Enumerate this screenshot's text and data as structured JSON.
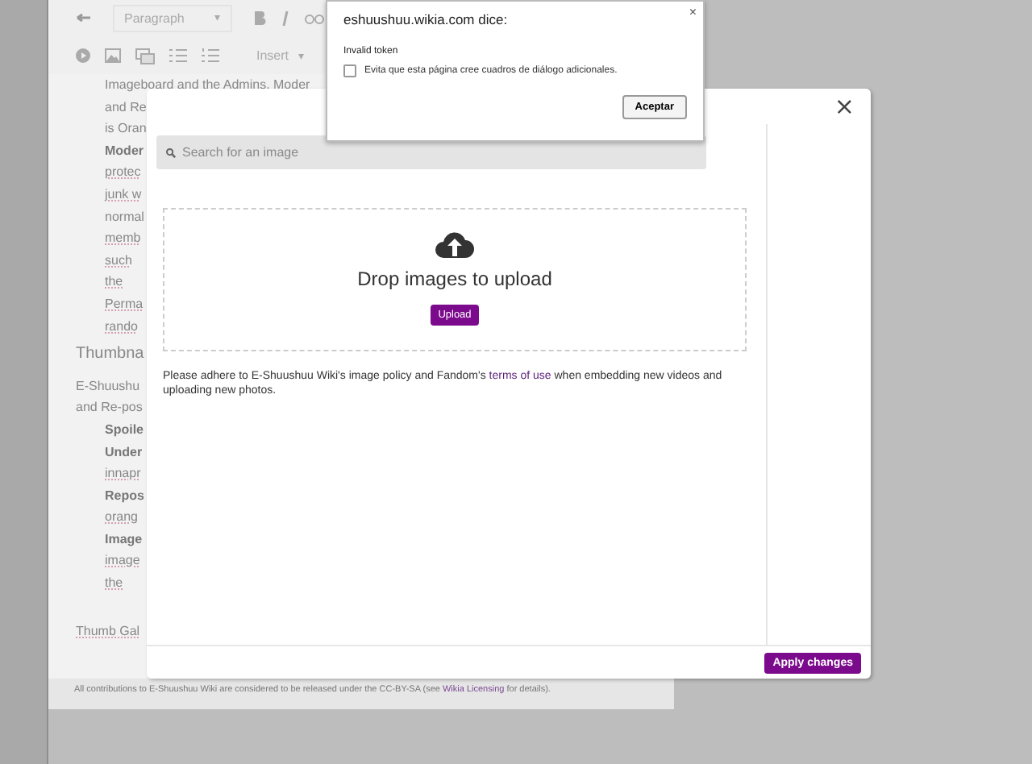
{
  "editor": {
    "toolbar": {
      "format": "Paragraph",
      "format_caret": "▾",
      "insert": "Insert",
      "insert_caret": "▾"
    },
    "lines": [
      {
        "kind": "cont",
        "text": "Imageboard and the Admins, Moder"
      },
      {
        "kind": "cont",
        "text": "and Re"
      },
      {
        "kind": "cont",
        "text": "is Oran"
      },
      {
        "kind": "bullet",
        "text": "Moder"
      },
      {
        "kind": "sub",
        "text": "protec"
      },
      {
        "kind": "sub",
        "text": "junk w"
      },
      {
        "kind": "subplain",
        "text": "normal"
      },
      {
        "kind": "sub",
        "text": "memb"
      },
      {
        "kind": "sub",
        "text": "such"
      },
      {
        "kind": "sub",
        "text": "the"
      },
      {
        "kind": "sub",
        "text": "Perma"
      },
      {
        "kind": "sub",
        "text": "rando"
      },
      {
        "kind": "heading",
        "text": "Thumbna"
      },
      {
        "kind": "text",
        "text": "E-Shuushu"
      },
      {
        "kind": "text",
        "text": "and Re-pos"
      },
      {
        "kind": "bullet",
        "text": "Spoile"
      },
      {
        "kind": "bullet",
        "text": "Under"
      },
      {
        "kind": "sub",
        "text": "innapr"
      },
      {
        "kind": "bullet",
        "text": "Repos"
      },
      {
        "kind": "sub",
        "text": "orang"
      },
      {
        "kind": "bullet",
        "text": "Image"
      },
      {
        "kind": "sub",
        "text": "image"
      },
      {
        "kind": "sub",
        "text": "the"
      },
      {
        "kind": "gap",
        "text": "Thumb Gal"
      }
    ],
    "footer": {
      "before": "All contributions to E-Shuushuu Wiki are considered to be released under the CC-BY-SA (see",
      "link": "Wikia Licensing",
      "after": "for details)."
    }
  },
  "modal": {
    "search": {
      "placeholder": "Search for an image"
    },
    "drop_text": "Drop images to upload",
    "upload_button": "Upload",
    "policy": {
      "before": "Please adhere to E-Shuushuu Wiki's image policy and Fandom's",
      "link": "terms of use",
      "after": "when embedding new videos and uploading new photos."
    },
    "apply_button": "Apply changes",
    "close": "×"
  },
  "alert": {
    "title": "eshuushuu.wikia.com dice:",
    "close": "×",
    "message": "Invalid token",
    "checkbox": {
      "label": "Evita que esta página cree cuadros de diálogo adicionales.",
      "checked": false
    },
    "button": "Aceptar"
  }
}
